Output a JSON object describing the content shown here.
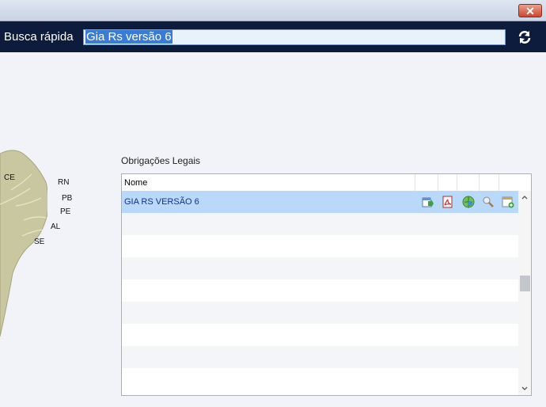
{
  "window": {
    "close_glyph": "✕"
  },
  "search": {
    "label": "Busca rápida",
    "value": "Gia Rs versão 6"
  },
  "map": {
    "states": [
      "CE",
      "RN",
      "PB",
      "PE",
      "AL",
      "SE"
    ]
  },
  "section": {
    "title": "Obrigações Legais"
  },
  "grid": {
    "header": {
      "name": "Nome"
    },
    "rows": [
      {
        "name": "GIA RS VERSÃO 6",
        "selected": true
      }
    ],
    "row_actions": [
      "export-icon",
      "pdf-icon",
      "web-icon",
      "search-icon",
      "calendar-add-icon"
    ]
  },
  "colors": {
    "header_bar": "#0d1b3c",
    "selection": "#b8d9f9",
    "map_land": "#c9c79f"
  }
}
